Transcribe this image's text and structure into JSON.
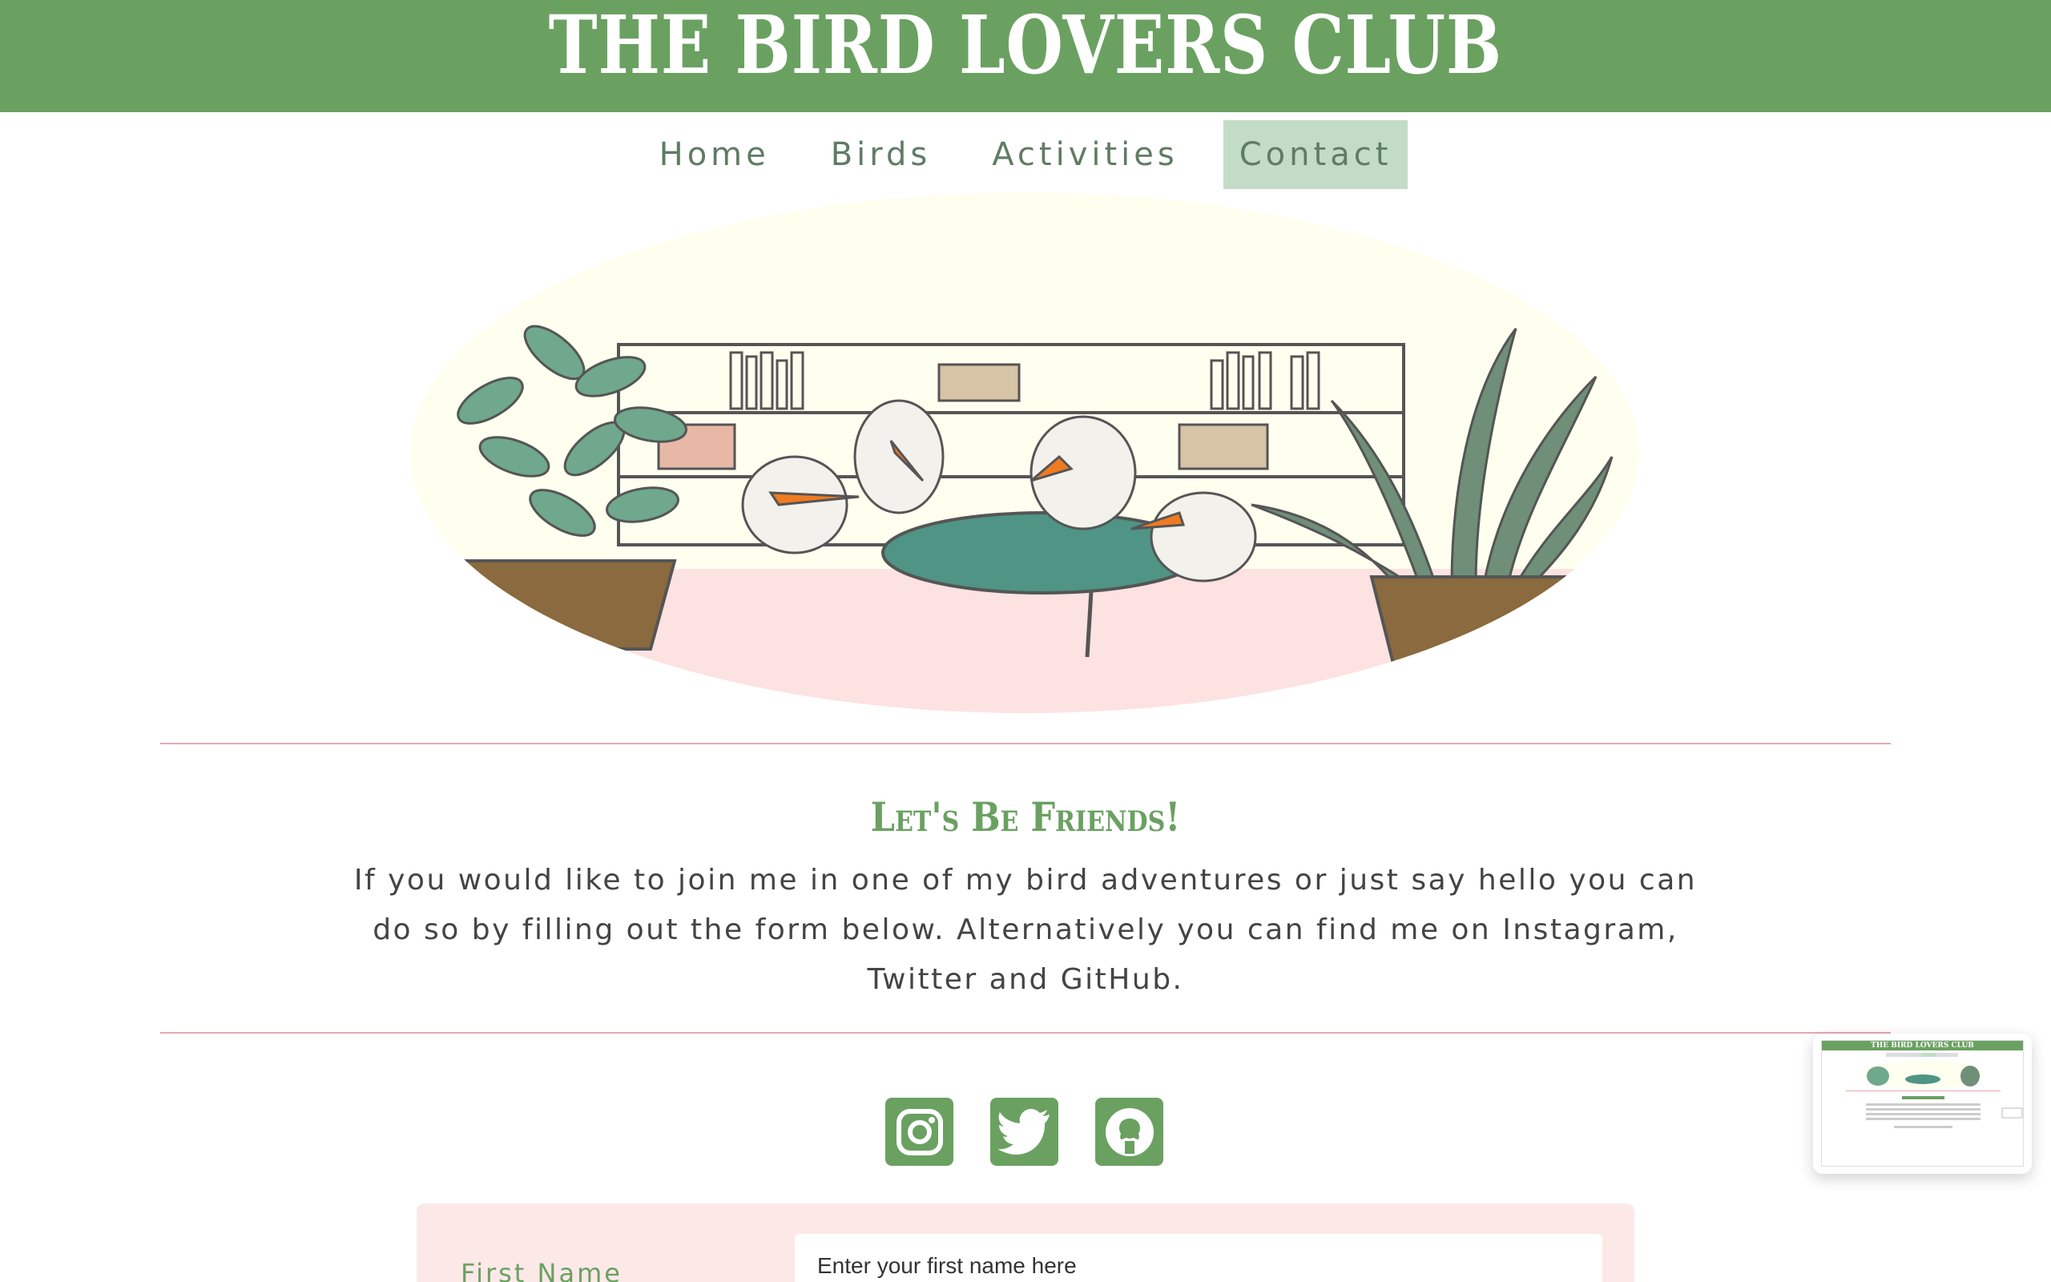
{
  "header": {
    "title": "THE BIRD LOVERS CLUB"
  },
  "nav": {
    "items": [
      {
        "label": "Home"
      },
      {
        "label": "Birds"
      },
      {
        "label": "Activities"
      },
      {
        "label": "Contact",
        "active": true
      }
    ]
  },
  "section": {
    "heading": "Let's Be Friends!",
    "intro": "If you would like to join me in one of my bird adventures or just say hello you can do so by filling out the form below. Alternatively you can find me on Instagram, Twitter and GitHub."
  },
  "social": [
    {
      "name": "instagram",
      "icon": "instagram-icon"
    },
    {
      "name": "twitter",
      "icon": "twitter-icon"
    },
    {
      "name": "github",
      "icon": "github-icon"
    }
  ],
  "form": {
    "first_name_label": "First Name",
    "first_name_placeholder": "Enter your first name here"
  },
  "thumbnail": {
    "title": "THE BIRD LOVERS CLUB"
  },
  "colors": {
    "brand_green": "#6aa161",
    "nav_active": "#c3dcc8",
    "divider": "#e7a8ac",
    "form_bg": "#fde8e8",
    "orange_beak": "#f07a22",
    "table_teal": "#4f9484"
  }
}
